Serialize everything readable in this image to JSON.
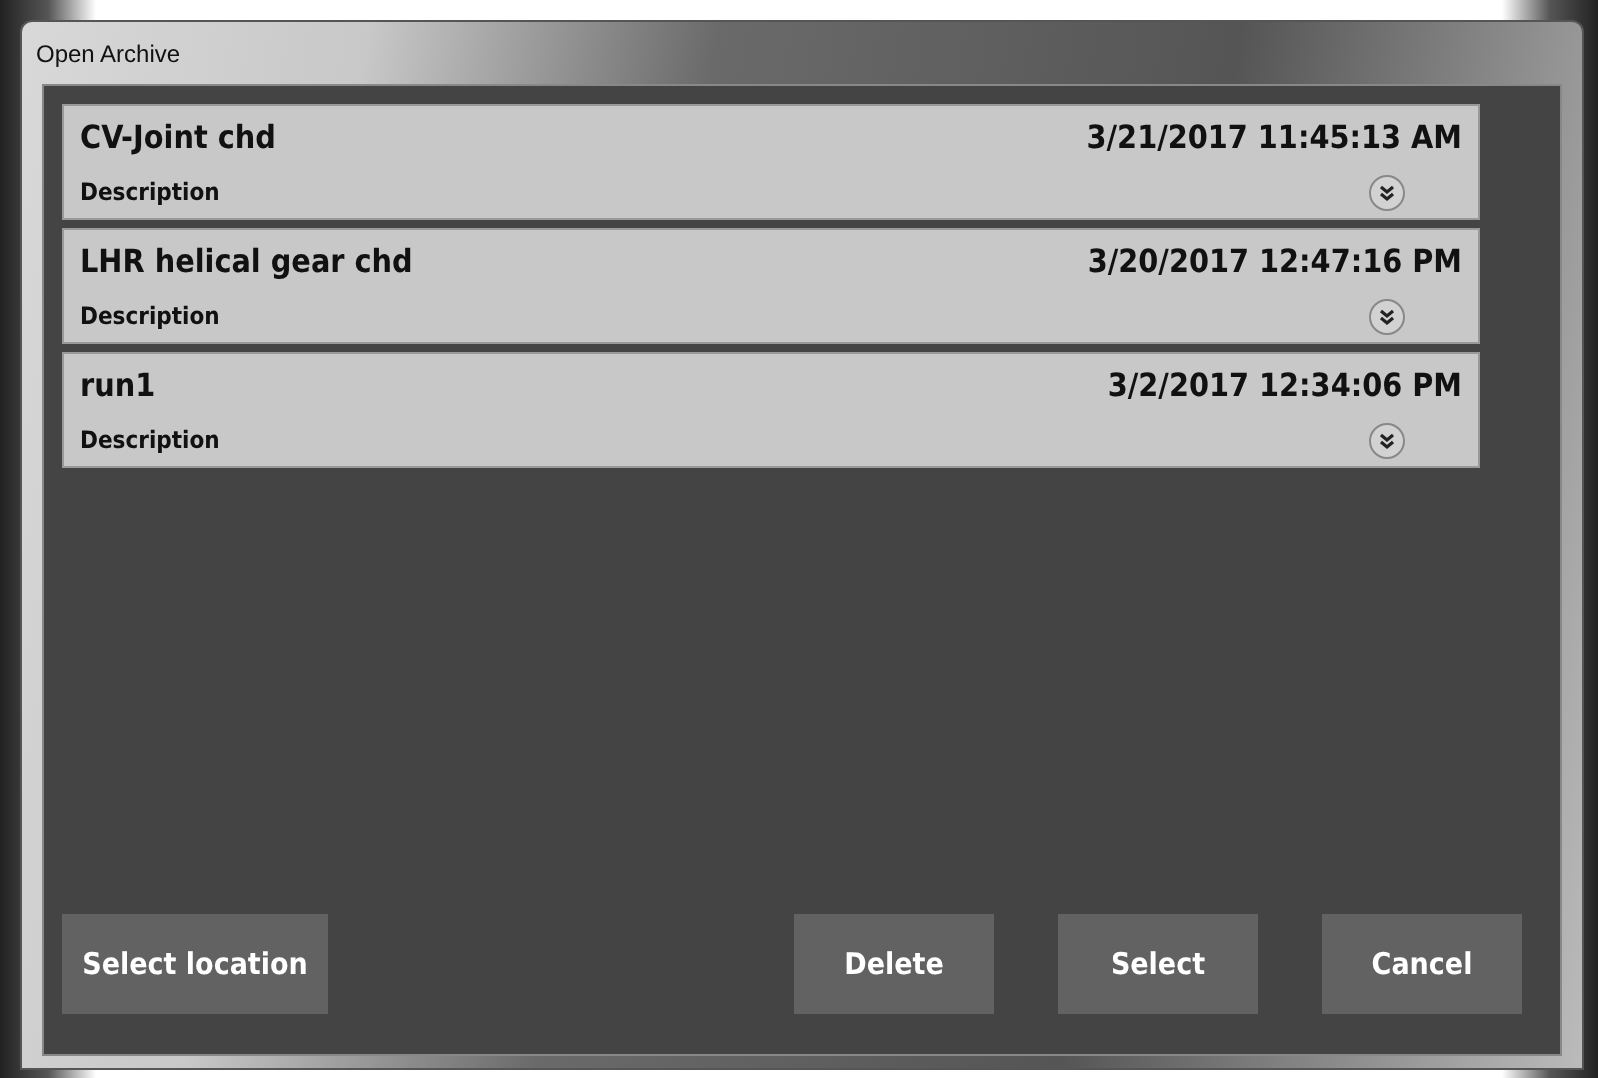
{
  "window": {
    "title": "Open Archive"
  },
  "archives": [
    {
      "name": "CV-Joint chd",
      "date": "3/21/2017 11:45:13 AM",
      "description_label": "Description"
    },
    {
      "name": "LHR helical gear chd",
      "date": "3/20/2017 12:47:16 PM",
      "description_label": "Description"
    },
    {
      "name": "run1",
      "date": "3/2/2017 12:34:06 PM",
      "description_label": "Description"
    }
  ],
  "buttons": [
    {
      "label": "Select location",
      "kind": "left"
    },
    {
      "label": "Delete",
      "kind": "right"
    },
    {
      "label": "Select",
      "kind": "right"
    },
    {
      "label": "Cancel",
      "kind": "right"
    }
  ]
}
